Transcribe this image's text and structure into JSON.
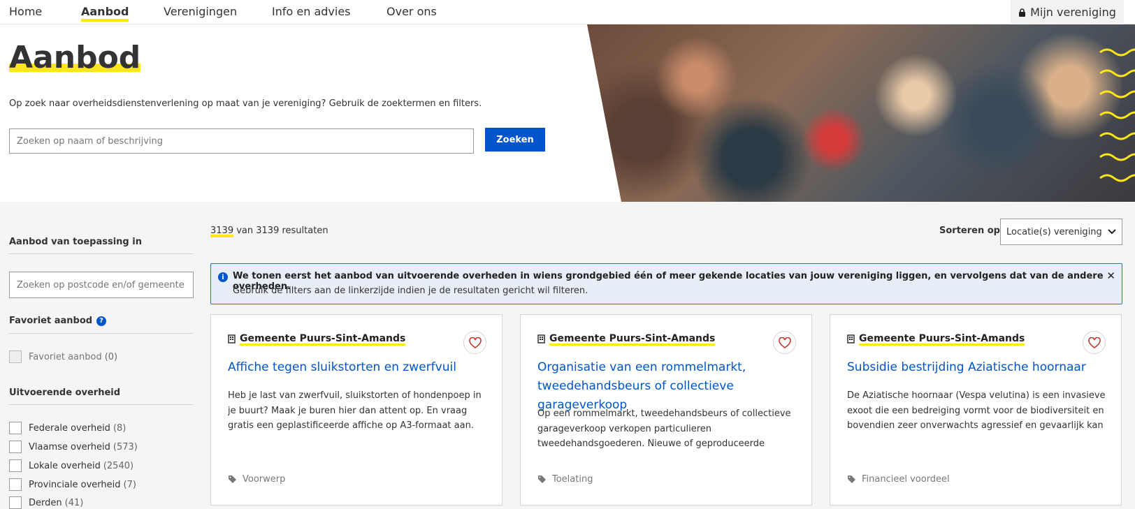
{
  "nav": {
    "items": [
      "Home",
      "Aanbod",
      "Verenigingen",
      "Info en advies",
      "Over ons"
    ],
    "active": "Aanbod",
    "account_label": "Mijn vereniging"
  },
  "hero": {
    "title": "Aanbod",
    "intro": "Op zoek naar overheidsdienstenverlening op maat van je vereniging? Gebruik de zoektermen en filters.",
    "search_placeholder": "Zoeken op naam of beschrijving",
    "search_button": "Zoeken"
  },
  "sidebar": {
    "location_heading": "Aanbod van toepassing in",
    "location_placeholder": "Zoeken op postcode en/of gemeente",
    "favorite_heading": "Favoriet aanbod",
    "favorite_help": "?",
    "favorite_option": {
      "label": "Favoriet aanbod",
      "count": "(0)"
    },
    "gov_heading": "Uitvoerende overheid",
    "gov_options": [
      {
        "label": "Federale overheid",
        "count": "(8)"
      },
      {
        "label": "Vlaamse overheid",
        "count": "(573)"
      },
      {
        "label": "Lokale overheid",
        "count": "(2540)"
      },
      {
        "label": "Provinciale overheid",
        "count": "(7)"
      },
      {
        "label": "Derden",
        "count": "(41)"
      }
    ]
  },
  "results": {
    "shown": "3139",
    "suffix": "van 3139 resultaten",
    "sort_label": "Sorteren op",
    "sort_value": "Locatie(s) vereniging"
  },
  "info": {
    "icon": "info-icon",
    "line1": "We tonen eerst het aanbod van uitvoerende overheden in wiens grondgebied één of meer gekende locaties van jouw vereniging liggen, en vervolgens dat van de andere overheden.",
    "line2": "Gebruik de filters aan de linkerzijde indien je de resultaten gericht wil filteren.",
    "close": "✕"
  },
  "cards": [
    {
      "org": "Gemeente Puurs-Sint-Amands",
      "title": "Affiche tegen sluikstorten en zwerfvuil",
      "description": "Heb je last van zwerfvuil, sluikstorten of hondenpoep in je buurt? Maak je buren hier dan attent op. En vraag gratis een geplastificeerde affiche op A3-formaat aan.",
      "tag": "Voorwerp"
    },
    {
      "org": "Gemeente Puurs-Sint-Amands",
      "title": "Organisatie van een rommelmarkt, tweedehandsbeurs of collectieve garageverkoop",
      "description": "Op een rommelmarkt, tweedehandsbeurs of collectieve garageverkoop verkopen particulieren tweedehandsgoederen. Nieuwe of geproduceerde producte...",
      "tag": "Toelating"
    },
    {
      "org": "Gemeente Puurs-Sint-Amands",
      "title": "Subsidie bestrijding Aziatische hoornaar",
      "description": "De Aziatische hoornaar (Vespa velutina) is een invasieve exoot die een bedreiging vormt voor de biodiversiteit en bovendien zeer onverwachts agressief en gevaarlijk kan zij...",
      "tag": "Financieel voordeel"
    }
  ],
  "colors": {
    "accent_yellow": "#ffe615",
    "primary_blue": "#0055cc",
    "heart_red": "#c0392b"
  }
}
